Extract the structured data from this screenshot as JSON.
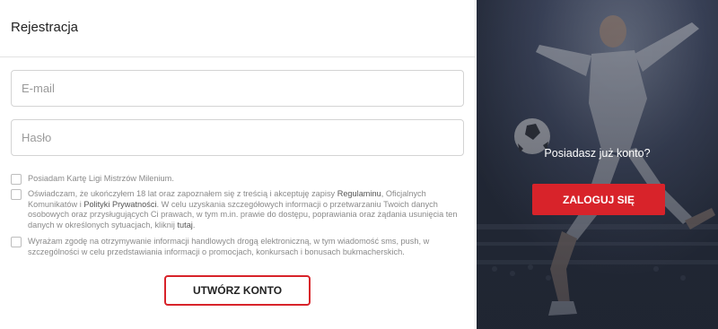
{
  "form": {
    "title": "Rejestracja",
    "email_placeholder": "E-mail",
    "password_placeholder": "Hasło",
    "consents": [
      {
        "text": "Posiadam Kartę Ligi Mistrzów Milenium.",
        "checked": false
      },
      {
        "text_before": "Oświadczam, że ukończyłem 18 lat oraz zapoznałem się z treścią i akceptuję zapisy ",
        "link1": "Regulaminu",
        "text_mid1": ", Oficjalnych Komunikatów i ",
        "link2": "Polityki Prywatności",
        "text_mid2": ". W celu uzyskania szczegółowych informacji o przetwarzaniu Twoich danych osobowych oraz przysługujących Ci prawach, w tym m.in. prawie do dostępu, poprawiania oraz żądania usunięcia ten danych w określonych sytuacjach, kliknij ",
        "link3": "tutaj",
        "text_end": ".",
        "checked": false
      },
      {
        "text": "Wyrażam zgodę na otrzymywanie informacji handlowych drogą elektroniczną, w tym wiadomość sms, push, w szczególności w celu przedstawiania informacji o promocjach, konkursach i bonusach bukmacherskich.",
        "checked": false
      }
    ],
    "submit_label": "UTWÓRZ KONTO"
  },
  "side_panel": {
    "question": "Posiadasz już konto?",
    "login_label": "ZALOGUJ SIĘ"
  },
  "colors": {
    "accent": "#d8232a",
    "panel_bg": "#2b3240"
  }
}
